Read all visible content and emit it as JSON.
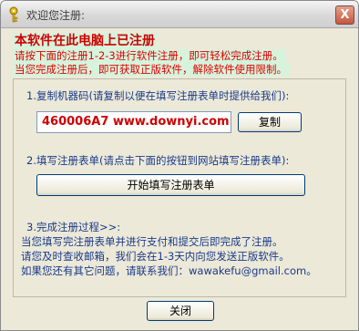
{
  "window": {
    "title": "欢迎您注册:",
    "close_glyph": "X"
  },
  "banner": {
    "headline": "本软件在此电脑上已注册",
    "line1": "请按下面的注册1-2-3进行软件注册，即可轻松完成注册。",
    "line2": "当您完成注册后，即可获取正版软件，解除软件使用限制。"
  },
  "step1": {
    "text": "1.复制机器码(请复制以便在填写注册表单时提供给我们):",
    "machine_code": "460006A7 www.downyi.com",
    "copy_label": "复制"
  },
  "step2": {
    "text": "2.填写注册表单(请点击下面的按钮到网站填写注册表单):",
    "button_label": "开始填写注册表单"
  },
  "step3": {
    "text": "3.完成注册过程>>:",
    "line1": "当您填写完注册表单并进行支付和提交后即完成了注册。",
    "line2": "请您及时查收邮箱，我们会在1-3天内向您发送正版软件。",
    "line3": "如果您还有其它问题，请联系我们：wawakefu@gmail.com。"
  },
  "footer": {
    "close_label": "关闭"
  },
  "icons": {
    "title_icon": "key-icon"
  },
  "colors": {
    "headline": "#d00000",
    "banner_bg": "#d6f3dc",
    "step_text": "#1a3a8a",
    "window_bg": "#ece9d8"
  }
}
